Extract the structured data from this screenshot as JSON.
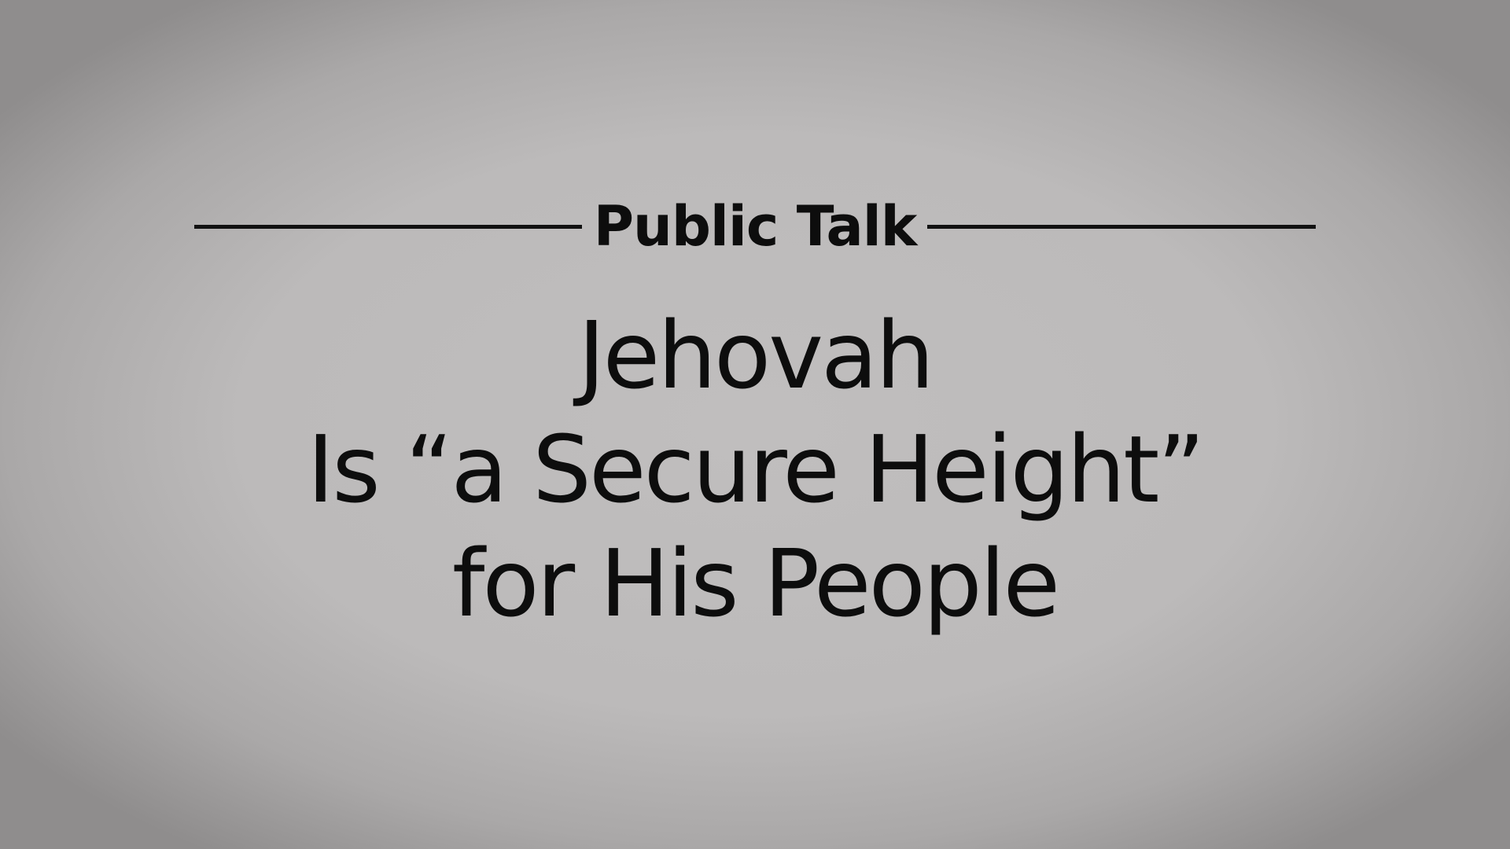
{
  "header": {
    "label": "Public Talk"
  },
  "title": {
    "lines": [
      "Jehovah",
      "Is “a Secure Height”",
      "for His People"
    ]
  },
  "colors": {
    "background": "#bdbbbb",
    "text": "#0d0d0d",
    "rule": "#111111"
  }
}
